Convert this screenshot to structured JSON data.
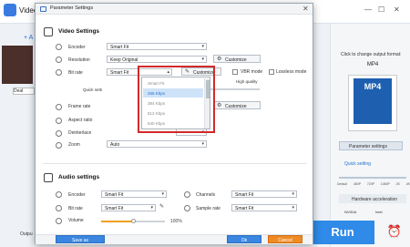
{
  "background_app": {
    "app_name": "Video",
    "add_label": "+ A",
    "thumb_label": "Deal",
    "right_hint": "Click to change output format:",
    "format": "MP4",
    "format_card_text": "MP4",
    "param_button": "Parameter settings",
    "quick_setting": "Quick setting",
    "quality_labels": [
      "480P",
      "1080P",
      "4K",
      "Default",
      "720P",
      "2K"
    ],
    "hw_accel": "Hardware acceleration",
    "gpu_labels": [
      "NVIDIA",
      "Intel"
    ],
    "run_label": "Run",
    "output_label": "Outpu"
  },
  "dialog": {
    "title": "Parameter Settings",
    "video_section": "Video Settings",
    "audio_section": "Audio settings",
    "video": {
      "encoder_label": "Encoder",
      "encoder_value": "Smart Fit",
      "resolution_label": "Resolution",
      "resolution_value": "Keep Original",
      "bitrate_label": "Bit rate",
      "bitrate_value": "Smart Fit",
      "customize": "Customize",
      "vbr_label": "VBR mode",
      "lossless_label": "Lossless mode",
      "quick_setting": "Quick setti",
      "default_label": "Default",
      "high_quality": "High quality",
      "framerate_label": "Frame rate",
      "aspect_label": "Aspect ratio",
      "deinterlace_label": "Deinterlace",
      "zoom_label": "Zoom",
      "zoom_value": "Auto"
    },
    "bitrate_options": [
      "Smart Fit",
      "256 Kbps",
      "384 Kbps",
      "512 Kbps",
      "640 Kbps"
    ],
    "bitrate_highlighted_index": 1,
    "audio": {
      "encoder_label": "Encoder",
      "encoder_value": "Smart Fit",
      "channels_label": "Channels",
      "channels_value": "Smart Fit",
      "bitrate_label": "Bit rate",
      "bitrate_value": "Smart Fit",
      "samplerate_label": "Sample rate",
      "samplerate_value": "Smart Fit",
      "volume_label": "Volume",
      "volume_pct": "100%",
      "volume_level": 0.5
    },
    "footer": {
      "save_as": "Save as",
      "ok": "Ok",
      "cancel": "Cancel"
    }
  },
  "colors": {
    "accent_blue": "#3a86e0",
    "cancel_orange": "#f08a24",
    "highlight_red": "#d12a2a"
  }
}
